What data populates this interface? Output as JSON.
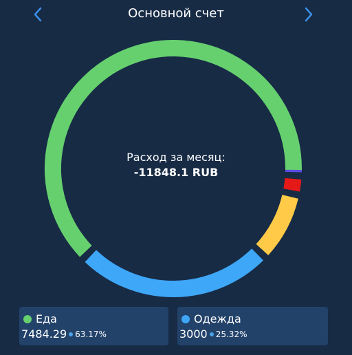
{
  "header": {
    "title": "Основной счет",
    "left_icon": "chevron-left-icon",
    "right_icon": "chevron-right-icon",
    "arrow_color": "#3c8fe6"
  },
  "summary": {
    "label": "Расход за месяц:",
    "value": "-11848.1 RUB"
  },
  "chart_data": {
    "type": "donut",
    "total": "-11848.1 RUB",
    "slices": [
      {
        "name": "Еда",
        "amount": 7484.29,
        "percent": 63.17,
        "color": "#66d06f"
      },
      {
        "name": "Одежда",
        "amount": 3000,
        "percent": 25.32,
        "color": "#3ea7f8"
      },
      {
        "amount": 1050,
        "percent": 8.9,
        "color": "#ffca47"
      },
      {
        "amount": 280,
        "percent": 2.4,
        "color": "#e61919"
      },
      {
        "amount": 35,
        "percent": 0.3,
        "color": "#5a4ee3"
      }
    ]
  },
  "categories": [
    {
      "name": "Еда",
      "amount": "7484.29",
      "percent": "63.17%",
      "color": "#66d06f"
    },
    {
      "name": "Одежда",
      "amount": "3000",
      "percent": "25.32%",
      "color": "#3ea7f8"
    }
  ]
}
